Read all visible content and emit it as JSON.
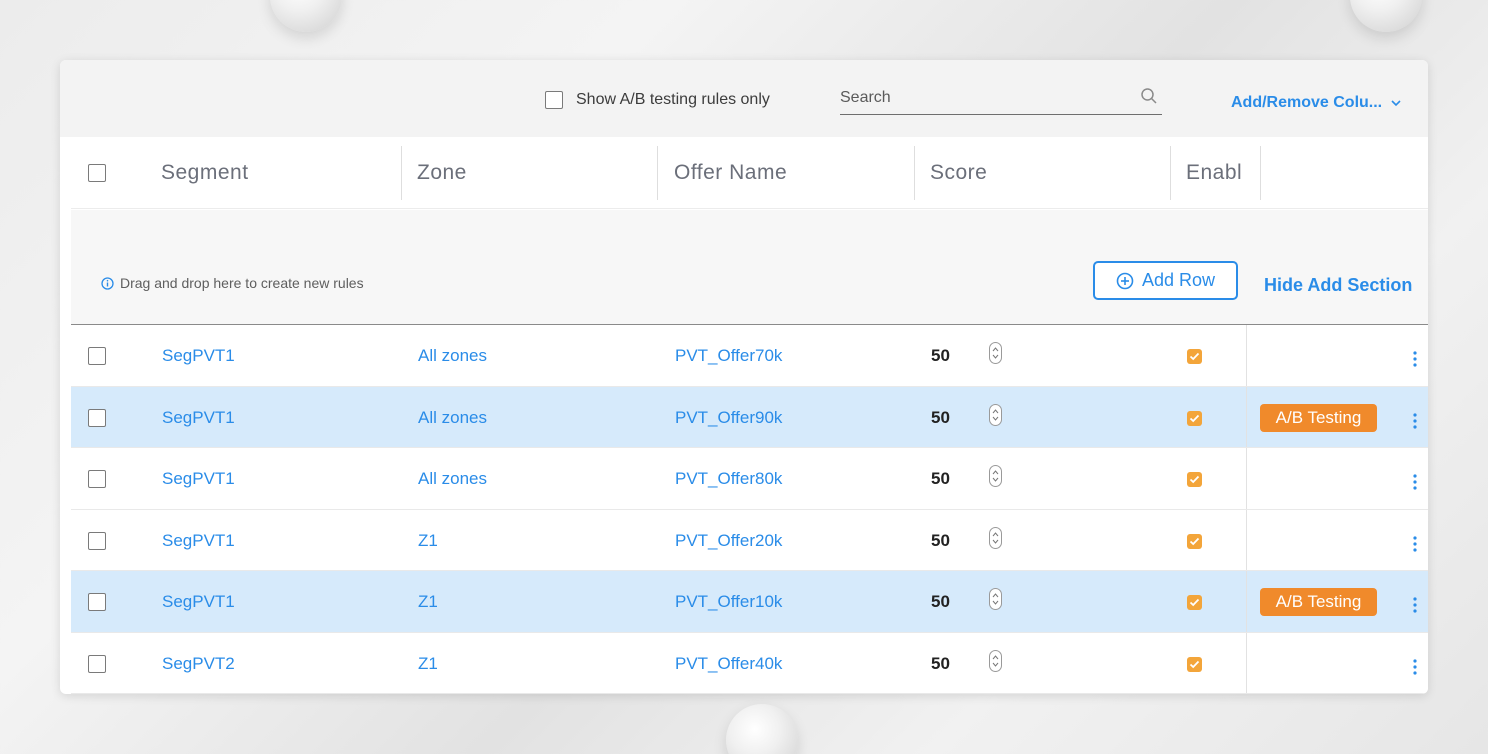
{
  "toolbar": {
    "ab_filter_label": "Show A/B testing rules only",
    "search_placeholder": "Search",
    "add_remove_columns_label": "Add/Remove Colu..."
  },
  "table": {
    "columns": [
      "Segment",
      "Zone",
      "Offer Name",
      "Score",
      "Enabl"
    ],
    "rows": [
      {
        "segment": "SegPVT1",
        "zone": "All zones",
        "offer": "PVT_Offer70k",
        "score": "50",
        "enabled": true,
        "ab_testing": false
      },
      {
        "segment": "SegPVT1",
        "zone": "All zones",
        "offer": "PVT_Offer90k",
        "score": "50",
        "enabled": true,
        "ab_testing": true
      },
      {
        "segment": "SegPVT1",
        "zone": "All zones",
        "offer": "PVT_Offer80k",
        "score": "50",
        "enabled": true,
        "ab_testing": false
      },
      {
        "segment": "SegPVT1",
        "zone": "Z1",
        "offer": "PVT_Offer20k",
        "score": "50",
        "enabled": true,
        "ab_testing": false
      },
      {
        "segment": "SegPVT1",
        "zone": "Z1",
        "offer": "PVT_Offer10k",
        "score": "50",
        "enabled": true,
        "ab_testing": true
      },
      {
        "segment": "SegPVT2",
        "zone": "Z1",
        "offer": "PVT_Offer40k",
        "score": "50",
        "enabled": true,
        "ab_testing": false
      }
    ],
    "ab_tag_label": "A/B Testing"
  },
  "add_section": {
    "drop_hint": "Drag and drop here to create new rules",
    "add_row_label": "Add Row",
    "hide_label": "Hide Add Section"
  },
  "colors": {
    "accent": "#2a8ce8",
    "highlight_row": "#d6eafb",
    "ab_tag": "#f08a2b",
    "enabled_check": "#f3a53a"
  },
  "icons": {
    "search": "search-icon",
    "chevron": "chevron-down-icon",
    "info": "info-icon",
    "add": "plus-circle-icon",
    "spinner": "spinner-arrows-icon",
    "more": "kebab-menu-icon"
  }
}
